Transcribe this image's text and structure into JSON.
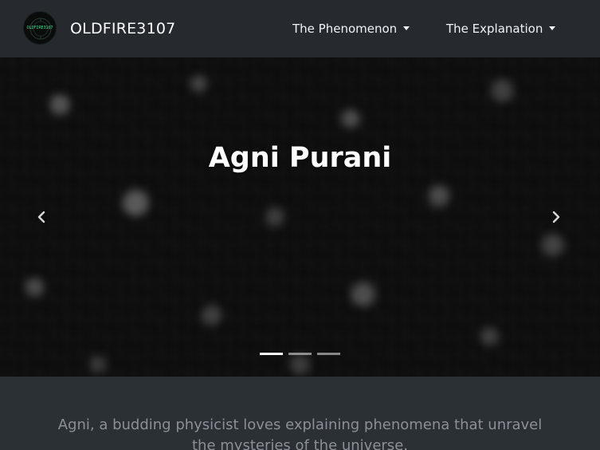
{
  "navbar": {
    "logo_text": "OLDFIRE3107",
    "brand": "OLDFIRE3107",
    "items": [
      {
        "label": "The Phenomenon",
        "icon": "caret-down-icon"
      },
      {
        "label": "The Explanation",
        "icon": "caret-down-icon"
      }
    ]
  },
  "carousel": {
    "caption": "Agni Purani",
    "prev_icon": "chevron-left-icon",
    "next_icon": "chevron-right-icon",
    "slides_count": 3,
    "active_slide": 1
  },
  "intro": {
    "text": "Agni, a budding physicist loves explaining phenomena that unravel the mysteries of the universe."
  },
  "colors": {
    "navbar_bg": "#262a2f",
    "page_bg": "#2b3035",
    "logo_accent": "#2fe08a",
    "intro_text": "#8c9096"
  }
}
